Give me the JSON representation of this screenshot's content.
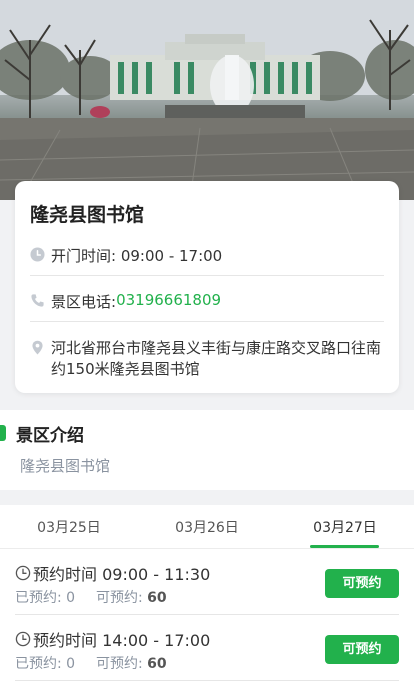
{
  "hero": {
    "alt_icon": "library-fountain-photo"
  },
  "info": {
    "title": "隆尧县图书馆",
    "hours_label": "开门时间: 09:00 - 17:00",
    "phone_label": "景区电话: ",
    "phone_number": "03196661809",
    "address": "河北省邢台市隆尧县义丰街与康庄路交叉路口往南约150米隆尧县图书馆"
  },
  "intro": {
    "title": "景区介绍",
    "text": "隆尧县图书馆"
  },
  "tabs": [
    {
      "label": "03月25日"
    },
    {
      "label": "03月26日"
    },
    {
      "label": "03月27日"
    }
  ],
  "selected_tab": "03月27日",
  "slots": [
    {
      "time": "预约时间 09:00 - 11:30",
      "booked_label": "已预约:",
      "booked": "0",
      "available_label": "可预约:",
      "available": "60",
      "button": "可预约"
    },
    {
      "time": "预约时间 14:00 - 17:00",
      "booked_label": "已预约:",
      "booked": "0",
      "available_label": "可预约:",
      "available": "60",
      "button": "可预约"
    }
  ],
  "colors": {
    "accent": "#22b14c",
    "muted": "#8a93a0"
  }
}
